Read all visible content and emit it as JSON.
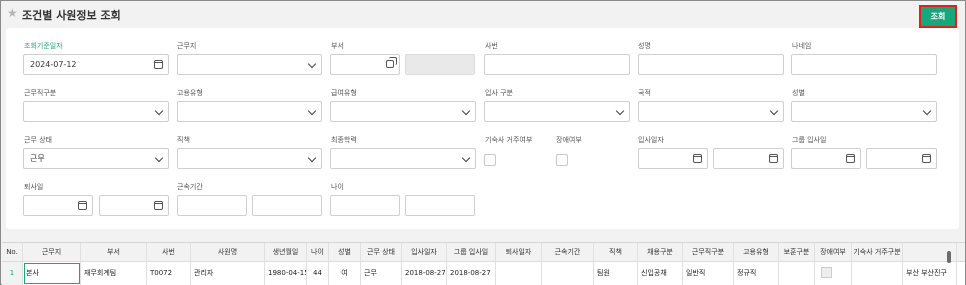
{
  "page": {
    "title": "조건별 사원정보 조회",
    "search_label": "조회",
    "marker": "①"
  },
  "filters": {
    "base_date": {
      "label": "조회기준일자",
      "value": "2024-07-12"
    },
    "work_site": {
      "label": "근무지",
      "value": ""
    },
    "dept": {
      "label": "부서",
      "value": ""
    },
    "emp_no": {
      "label": "사번",
      "value": ""
    },
    "name": {
      "label": "성명",
      "value": ""
    },
    "age_label": "나네임",
    "work_type": {
      "label": "근무직구분",
      "value": ""
    },
    "employ_type": {
      "label": "고용유형",
      "value": ""
    },
    "pay_type": {
      "label": "급여유형",
      "value": ""
    },
    "join_type": {
      "label": "입사 구분",
      "value": ""
    },
    "nationality": {
      "label": "국적",
      "value": ""
    },
    "gender": {
      "label": "성별",
      "value": ""
    },
    "work_status": {
      "label": "근무 상태",
      "value": "근무"
    },
    "position": {
      "label": "직책",
      "value": ""
    },
    "education": {
      "label": "최종학력",
      "value": ""
    },
    "dorm": {
      "label": "기숙사 거주여부"
    },
    "disabled": {
      "label": "장애여부"
    },
    "join_date": {
      "label": "입사일자"
    },
    "group_join": {
      "label": "그룹 입사일"
    },
    "resign": {
      "label": "퇴사일"
    },
    "tenure": {
      "label": "근속기간"
    },
    "age": {
      "label": "나이"
    }
  },
  "grid": {
    "columns": [
      "No.",
      "근무지",
      "부서",
      "사번",
      "사원명",
      "생년월일",
      "나이",
      "성별",
      "근무 상태",
      "입사일자",
      "그룹 입사일",
      "퇴사일자",
      "근속기간",
      "직책",
      "채용구분",
      "근무직구분",
      "고용유형",
      "보훈구분",
      "장애여부",
      "기숙사 거주구분",
      ""
    ],
    "rows": [
      [
        "1",
        "본사",
        "재무회계팀",
        "T0072",
        "관리자",
        "1980-04-15",
        "44",
        "여",
        "근무",
        "2018-08-27",
        "2018-08-27",
        "",
        "",
        "팀원",
        "신입공채",
        "일반직",
        "정규직",
        "",
        "",
        "",
        "부산 부산진구"
      ]
    ]
  },
  "colors": {
    "accent": "#16a77a",
    "marker": "#d41010"
  }
}
